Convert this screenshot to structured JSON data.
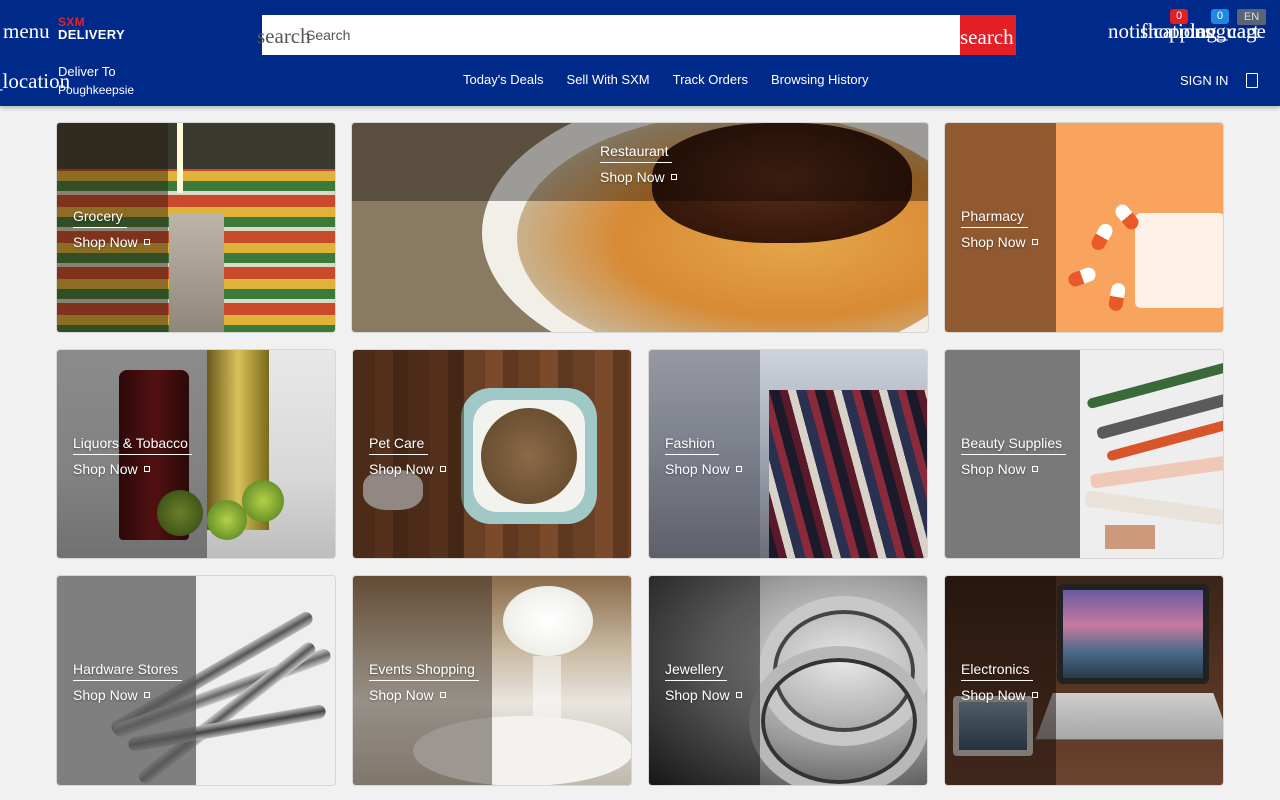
{
  "header": {
    "menu_icon": "menu",
    "logo_line1": "SXM",
    "logo_line2": "DELIVERY",
    "search_icon": "search",
    "search_placeholder": "Search",
    "search_button": "search",
    "notifications_icon": "notifications",
    "cart_icon": "shopping_cart",
    "language_icon": "language",
    "notifications_count": "0",
    "cart_count": "0",
    "language_code": "EN",
    "location_icon": "_location",
    "deliver_label": "Deliver To",
    "deliver_city": "Poughkeepsie",
    "nav": [
      "Today's Deals",
      "Sell With SXM",
      "Track Orders",
      "Browsing History"
    ],
    "sign_in": "SIGN IN"
  },
  "categories": [
    {
      "name": "Grocery",
      "cta": "Shop Now"
    },
    {
      "name": "Restaurant",
      "cta": "Shop Now"
    },
    {
      "name": "Pharmacy",
      "cta": "Shop Now"
    },
    {
      "name": "Liquors & Tobacco",
      "cta": "Shop Now"
    },
    {
      "name": "Pet Care",
      "cta": "Shop Now"
    },
    {
      "name": "Fashion",
      "cta": "Shop Now"
    },
    {
      "name": "Beauty Supplies",
      "cta": "Shop Now"
    },
    {
      "name": "Hardware Stores",
      "cta": "Shop Now"
    },
    {
      "name": "Events Shopping",
      "cta": "Shop Now"
    },
    {
      "name": "Jewellery",
      "cta": "Shop Now"
    },
    {
      "name": "Electronics",
      "cta": "Shop Now"
    }
  ],
  "colors": {
    "header_bg": "#002a8a",
    "accent_red": "#e31e24",
    "badge_blue": "#1e88e5",
    "page_bg": "#f1f1f1"
  }
}
